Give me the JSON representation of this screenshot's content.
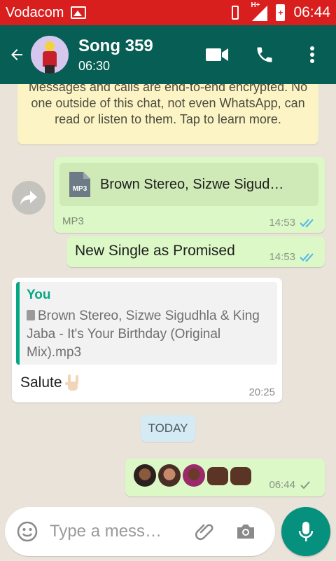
{
  "status_bar": {
    "carrier": "Vodacom",
    "network": "H+",
    "time": "06:44"
  },
  "header": {
    "title": "Song 359",
    "subtitle": "06:30"
  },
  "chat": {
    "encryption_notice": "Messages and calls are end-to-end encrypted. No one outside of this chat, not even WhatsApp, can read or listen to them. Tap to learn more.",
    "file_message": {
      "icon_label": "MP3",
      "filename": "Brown Stereo, Sizwe Sigud…",
      "type": "MP3",
      "time": "14:53"
    },
    "text_message": {
      "text": "New Single as Promised",
      "time": "14:53"
    },
    "reply_message": {
      "quote_author": "You",
      "quote_text": "Brown Stereo, Sizwe Sigudhla & King Jaba - It's Your Birthday (Original Mix).mp3",
      "text": "Salute",
      "time": "20:25"
    },
    "date_divider": "TODAY",
    "emoji_message": {
      "time": "06:44"
    }
  },
  "composer": {
    "placeholder": "Type a mess…"
  },
  "colors": {
    "status_bar": "#d91e1e",
    "app_bar": "#075e54",
    "outgoing_bubble": "#dcf8c6",
    "accent": "#06a884",
    "read_tick": "#4fb6ec"
  }
}
